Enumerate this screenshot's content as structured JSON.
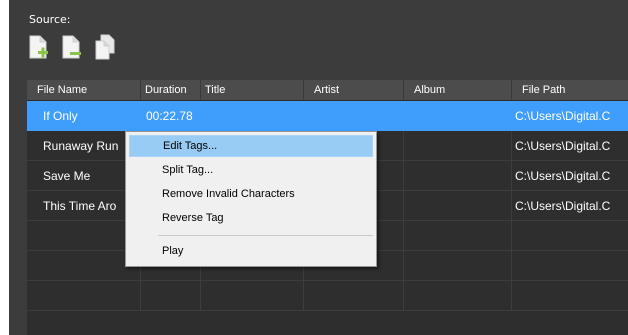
{
  "source": {
    "label": "Source:"
  },
  "toolbar": {
    "buttons": [
      {
        "name": "add-file-icon",
        "icon": "document-plus"
      },
      {
        "name": "remove-file-icon",
        "icon": "document-minus"
      },
      {
        "name": "copy-file-icon",
        "icon": "documents-stack"
      }
    ]
  },
  "table": {
    "headers": {
      "file_name": "File Name",
      "duration": "Duration",
      "title": "Title",
      "artist": "Artist",
      "album": "Album",
      "file_path": "File Path"
    },
    "rows": [
      {
        "file_name": "If Only",
        "duration": "00:22.78",
        "title": "",
        "artist": "",
        "album": "",
        "file_path": "C:\\Users\\Digital.C"
      },
      {
        "file_name": "Runaway Run",
        "duration": "",
        "title": "",
        "artist": "",
        "album": "",
        "file_path": "C:\\Users\\Digital.C"
      },
      {
        "file_name": "Save Me",
        "duration": "",
        "title": "",
        "artist": "",
        "album": "",
        "file_path": "C:\\Users\\Digital.C"
      },
      {
        "file_name": "This Time Aro",
        "duration": "",
        "title": "",
        "artist": "",
        "album": "",
        "file_path": "C:\\Users\\Digital.C"
      },
      {
        "file_name": "",
        "duration": "",
        "title": "",
        "artist": "",
        "album": "",
        "file_path": ""
      },
      {
        "file_name": "",
        "duration": "",
        "title": "",
        "artist": "",
        "album": "",
        "file_path": ""
      },
      {
        "file_name": "",
        "duration": "",
        "title": "",
        "artist": "",
        "album": "",
        "file_path": ""
      }
    ]
  },
  "context_menu": {
    "items": {
      "edit_tags": "Edit Tags...",
      "split_tag": "Split Tag...",
      "remove_invalid": "Remove Invalid Characters",
      "reverse_tag": "Reverse Tag",
      "play": "Play"
    }
  },
  "colors": {
    "window_bg": "#3c3c3c",
    "grid_bg": "#2e2e2e",
    "selection": "#3f9dfb",
    "menu_bg": "#f0f0f0",
    "menu_hover": "#99ccf5"
  }
}
